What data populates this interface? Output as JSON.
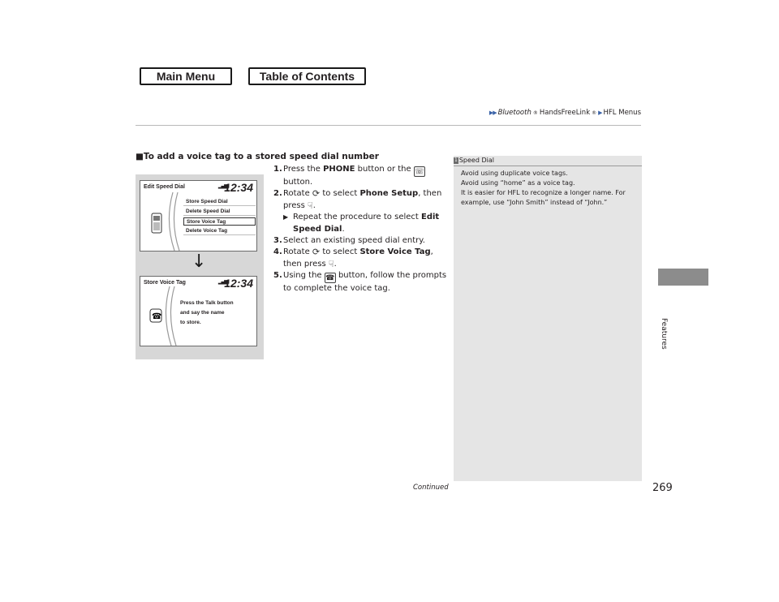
{
  "nav": {
    "main_menu": "Main Menu",
    "toc": "Table of Contents"
  },
  "breadcrumb": {
    "part1": "Bluetooth",
    "reg": "®",
    "part2": " HandsFreeLink",
    "reg2": "®",
    "part3": "HFL Menus"
  },
  "side_label": "Features",
  "heading": "■To add a voice tag to a stored speed dial number",
  "steps": {
    "s1_num": "1.",
    "s1_a": "Press the ",
    "s1_b": "PHONE",
    "s1_c": " button or the ",
    "s1_d": " button.",
    "s2_num": "2.",
    "s2_a": "Rotate ",
    "s2_b": " to select ",
    "s2_c": "Phone Setup",
    "s2_d": ", then press ",
    "s2_e": ".",
    "sub_a": "Repeat the procedure to select ",
    "sub_b": "Edit Speed Dial",
    "sub_c": ".",
    "s3_num": "3.",
    "s3_text": "Select an existing speed dial entry.",
    "s4_num": "4.",
    "s4_a": "Rotate ",
    "s4_b": " to select ",
    "s4_c": "Store Voice Tag",
    "s4_d": ", then press ",
    "s4_e": ".",
    "s5_num": "5.",
    "s5_a": "Using the ",
    "s5_b": " button, follow the prompts to complete the voice tag."
  },
  "screen1": {
    "title": "Edit Speed Dial",
    "time": "12:34",
    "items": [
      "Store Speed Dial",
      "Delete Speed Dial",
      "Store Voice Tag",
      "Delete Voice Tag"
    ]
  },
  "screen2": {
    "title": "Store Voice Tag",
    "time": "12:34",
    "line1": "Press the Talk button",
    "line2": "and say the name",
    "line3": "to store."
  },
  "note": {
    "badge": "1",
    "title": "Speed Dial",
    "line1": "Avoid using duplicate voice tags.",
    "line2": "Avoid using “home” as a voice tag.",
    "line3": "It is easier for HFL to recognize a longer name. For example, use “John Smith” instead of “John.”"
  },
  "continued": "Continued",
  "page_number": "269"
}
